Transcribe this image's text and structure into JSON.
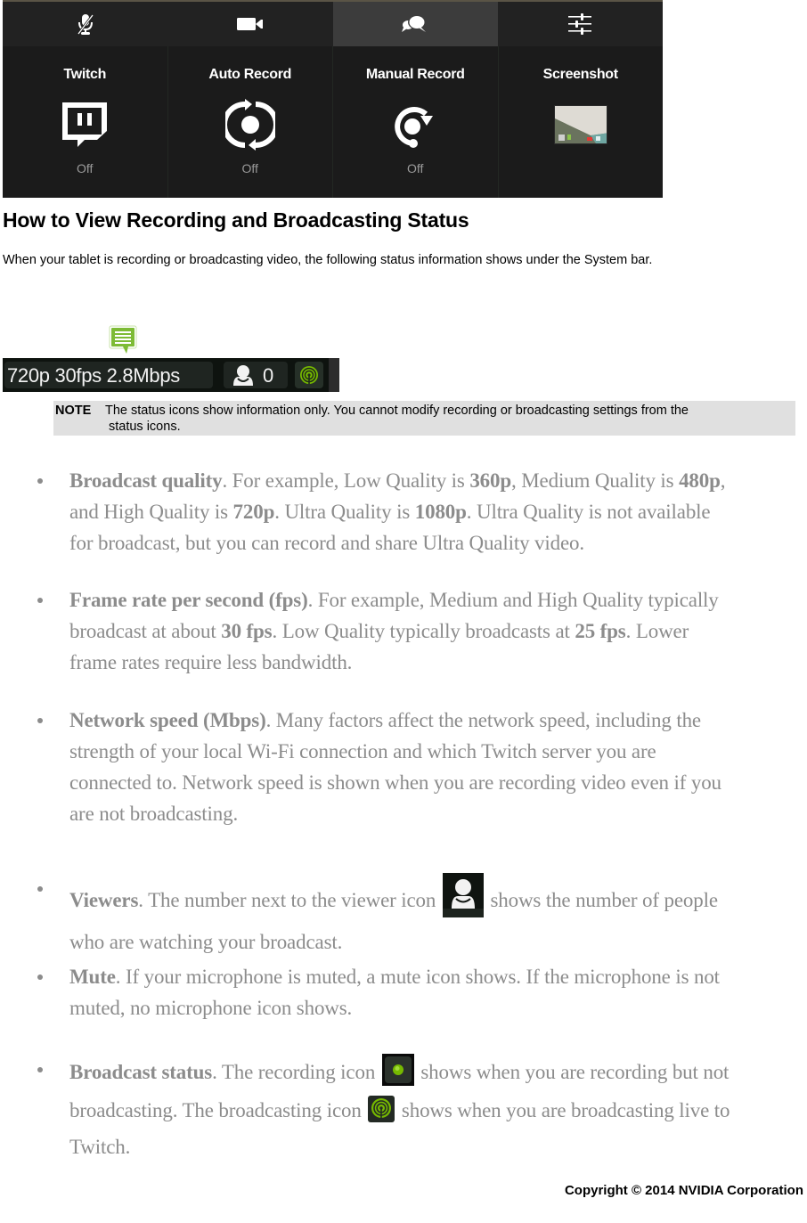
{
  "panel": {
    "tabs": [
      {
        "icon": "mic-muted-icon",
        "active": false
      },
      {
        "icon": "video-camera-icon",
        "active": false
      },
      {
        "icon": "chat-bubbles-icon",
        "active": true
      },
      {
        "icon": "sliders-icon",
        "active": false
      }
    ],
    "tiles": [
      {
        "label": "Twitch",
        "icon": "twitch-icon",
        "status": "Off"
      },
      {
        "label": "Auto Record",
        "icon": "auto-record-icon",
        "status": "Off"
      },
      {
        "label": "Manual Record",
        "icon": "manual-record-icon",
        "status": "Off"
      },
      {
        "label": "Screenshot",
        "icon": "screenshot-thumbnail",
        "status": ""
      }
    ]
  },
  "heading": "How to View Recording and Broadcasting Status",
  "intro": "When your tablet is recording or broadcasting video, the following status information shows under the System bar.",
  "status_bar": {
    "quality_text": "720p  30fps  2.8Mbps",
    "viewers_count": "0",
    "accent_color": "#76b900"
  },
  "note": {
    "label": "NOTE",
    "line1": "The status icons show information only. You cannot modify recording or broadcasting settings from the",
    "line2": "status icons."
  },
  "bullets": [
    {
      "title": "Broadcast quality",
      "lines": [
        [
          ". For example, Low Quality is ",
          {
            "b": "360p"
          },
          ", Medium Quality is ",
          {
            "b": "480p"
          },
          ","
        ],
        [
          "and High Quality is ",
          {
            "b": "720p"
          },
          ". Ultra Quality is ",
          {
            "b": "1080p"
          },
          ". Ultra Quality is not available"
        ],
        [
          "for broadcast, but you can record and share Ultra Quality video."
        ]
      ]
    },
    {
      "title": "Frame rate per second (fps)",
      "lines": [
        [
          ". For example, Medium and High Quality typically"
        ],
        [
          "broadcast at about ",
          {
            "b": "30 fps"
          },
          ". Low Quality typically broadcasts at ",
          {
            "b": "25 fps"
          },
          ". Lower"
        ],
        [
          "frame rates require less bandwidth."
        ]
      ]
    },
    {
      "title": "Network speed (Mbps)",
      "lines": [
        [
          ". Many factors affect the network speed, including the"
        ],
        [
          "strength of your local Wi-Fi connection and which Twitch server you are"
        ],
        [
          "connected to. Network speed is shown when you are recording video even if you"
        ],
        [
          "are not broadcasting."
        ]
      ]
    },
    {
      "title": "Viewers",
      "lines": [
        [
          ". The number next to the viewer icon ",
          {
            "icon": "viewer-icon"
          },
          " shows the number of people"
        ],
        [
          "who are watching your broadcast."
        ]
      ]
    },
    {
      "title": "Mute",
      "lines": [
        [
          ". If your microphone is muted, a mute icon shows. If the microphone is not"
        ],
        [
          "muted, no microphone icon shows."
        ]
      ]
    },
    {
      "title": "Broadcast status",
      "lines": [
        [
          ". The recording icon ",
          {
            "icon": "recording-icon"
          },
          " shows when you are recording but not"
        ],
        [
          "broadcasting. The broadcasting icon ",
          {
            "icon": "broadcasting-icon"
          },
          " shows when you are broadcasting live to"
        ],
        [
          "Twitch."
        ]
      ]
    }
  ],
  "copyright": "Copyright © 2014 NVIDIA Corporation"
}
